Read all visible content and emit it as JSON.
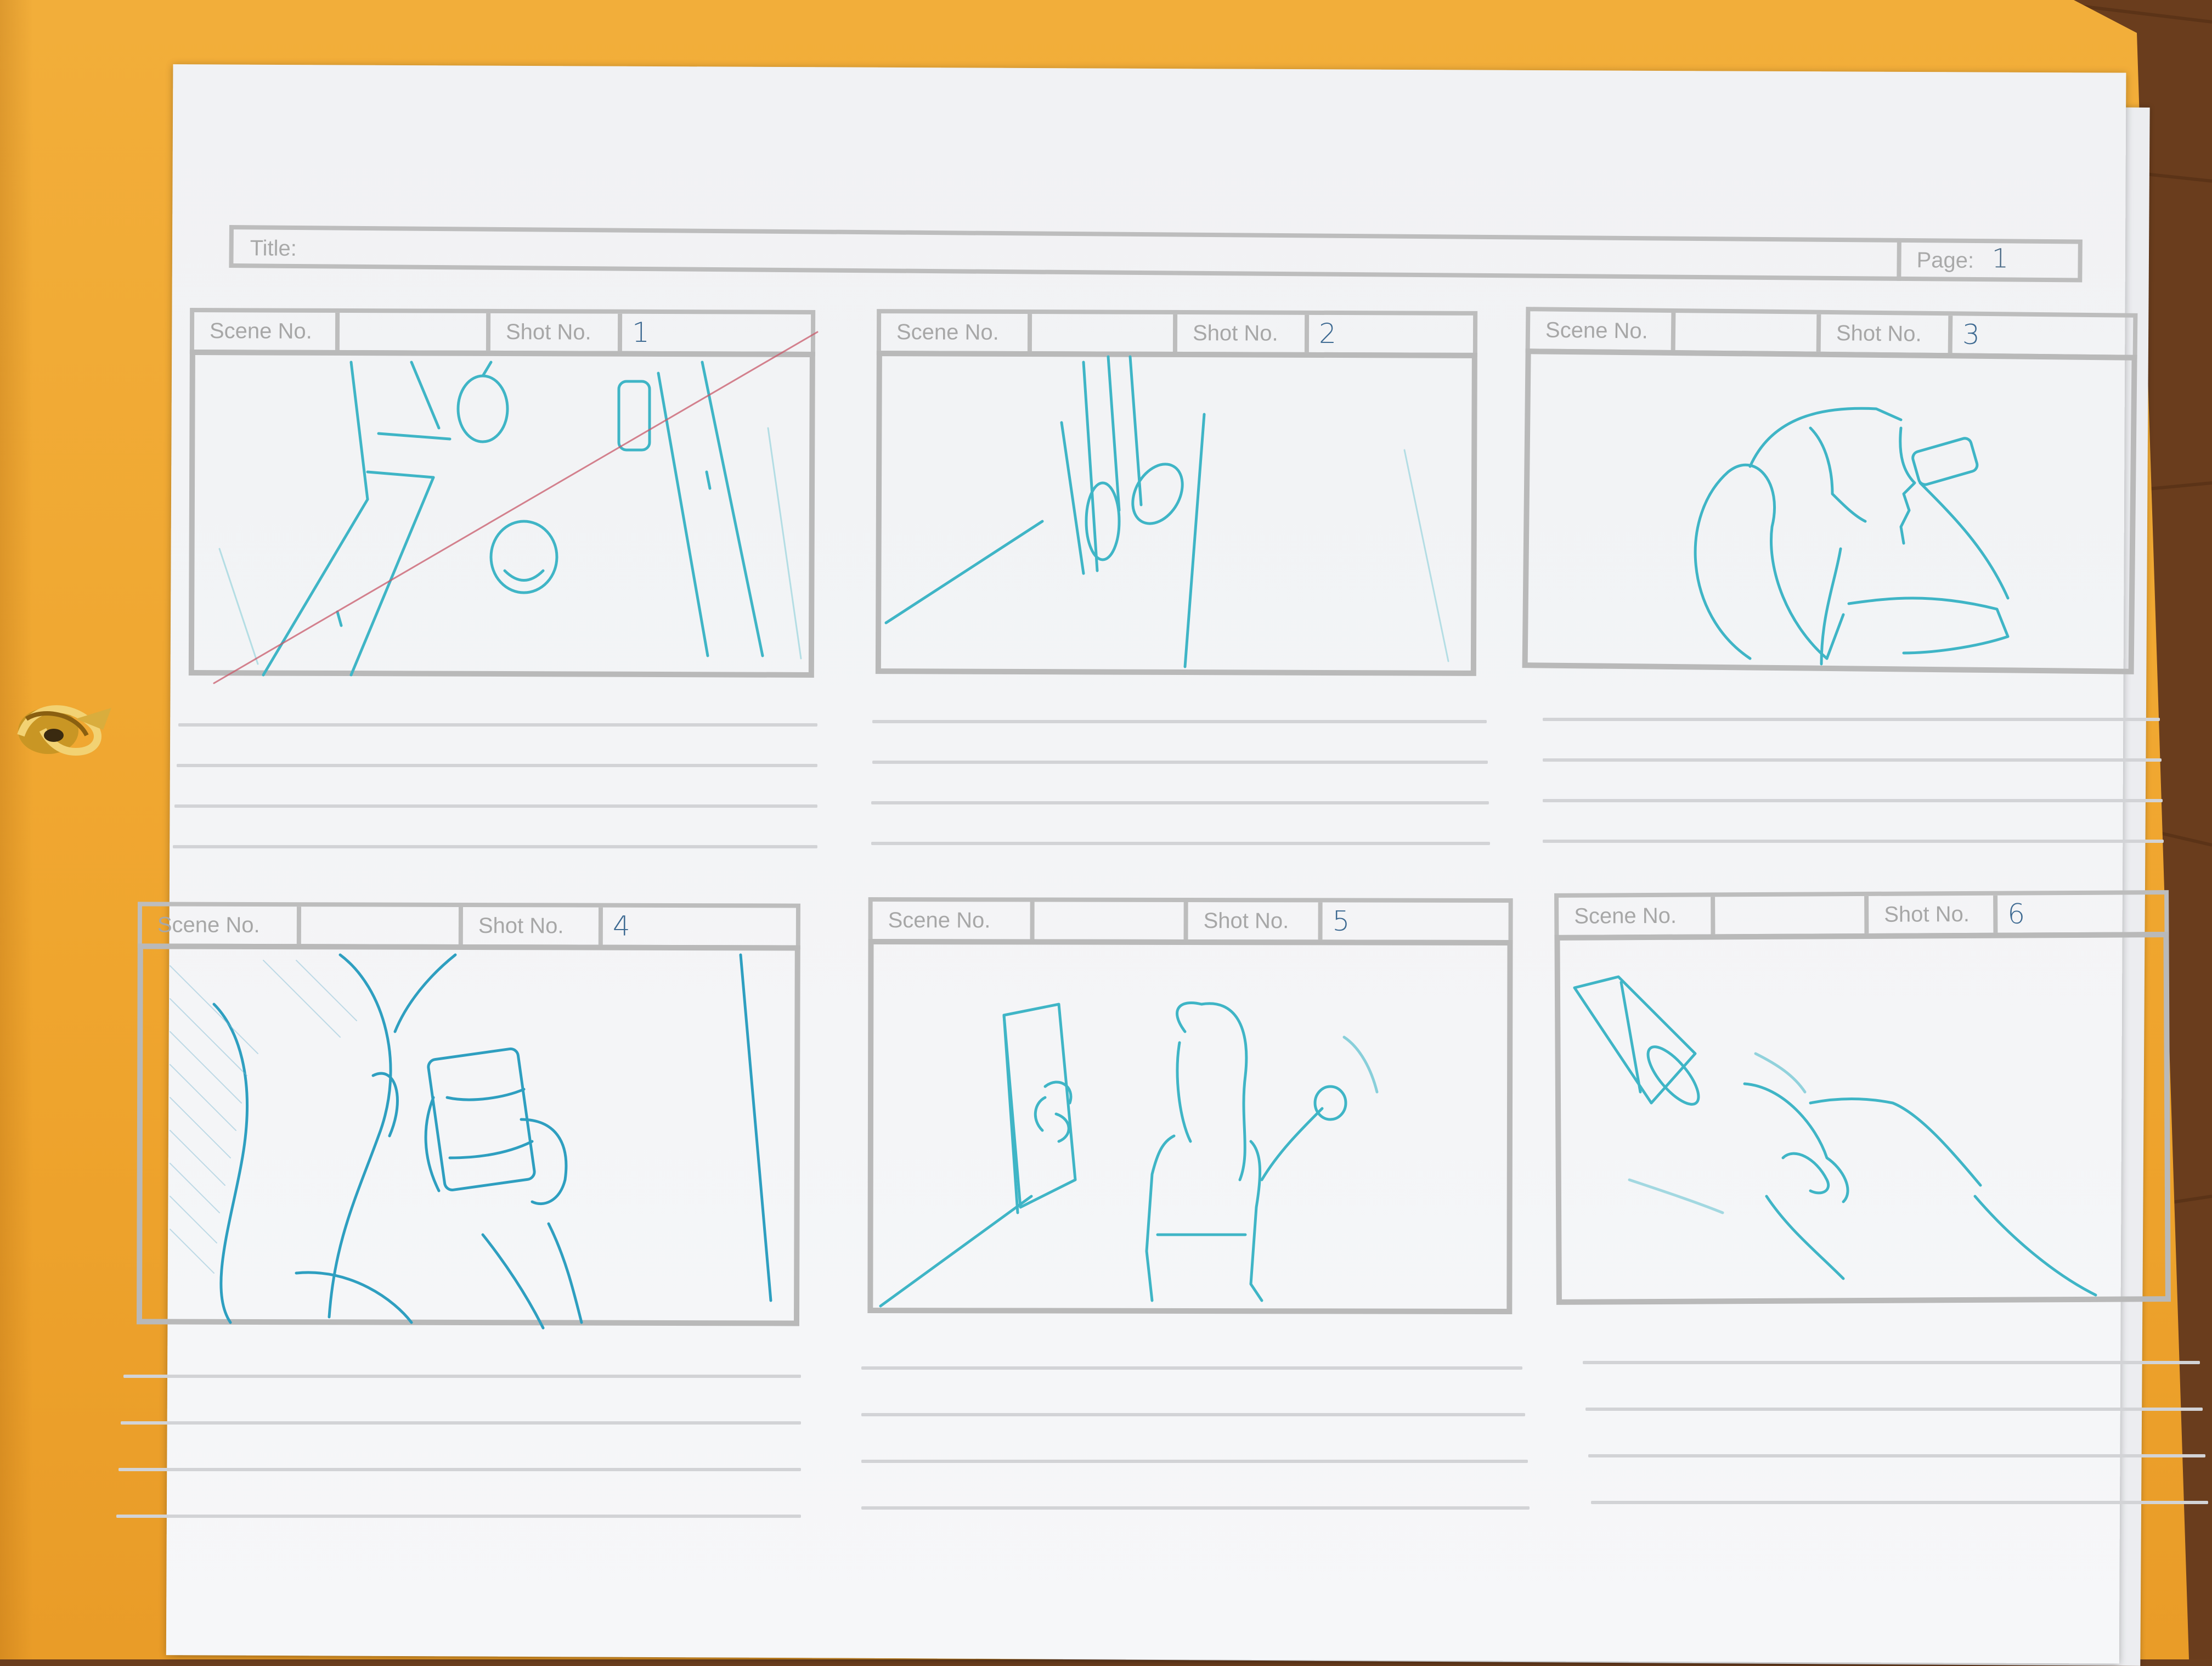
{
  "storyboard": {
    "title_label": "Title:",
    "page_label": "Page:",
    "page_value": "1",
    "scene_label": "Scene No.",
    "shot_label": "Shot No.",
    "panels": [
      {
        "scene": "",
        "shot": "1"
      },
      {
        "scene": "",
        "shot": "2"
      },
      {
        "scene": "",
        "shot": "3"
      },
      {
        "scene": "",
        "shot": "4"
      },
      {
        "scene": "",
        "shot": "5"
      },
      {
        "scene": "",
        "shot": "6"
      }
    ]
  },
  "colors": {
    "folder": "#f0a832",
    "paper": "#f3f4f6",
    "template_gray": "#bdbdbd",
    "pencil_blue": "#3fb5c6",
    "pen_blue": "#3e6a92",
    "wood": "#6b3e1e"
  },
  "icons": {
    "binder_clasp": "brass-fastener-icon"
  }
}
